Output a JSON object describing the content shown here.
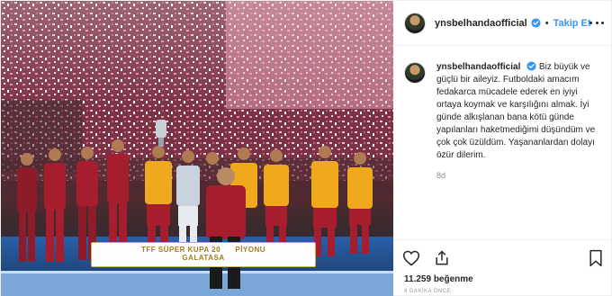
{
  "post": {
    "username": "ynsbelhandaofficial",
    "follow_label": "Takip Et",
    "caption": "Biz büyük ve güçlü bir aileyiz. Futboldaki amacım fedakarca mücadele ederek en iyiyi ortaya koymak ve karşılığını almak. İyi günde alkışlanan bana kötü günde yapılanları haketmediğimi düşündüm ve çok çok üzüldüm. Yaşananlardan dolayı özür dilerim.",
    "comment_time": "8d",
    "likes": "11.259 beğenme",
    "posted_ago": "8 DAKİKA ÖNCE"
  },
  "photo": {
    "banner_line1": "TFF SÜPER KUPA 20",
    "banner_line2": "GALATASA",
    "banner_suffix": "PİYONU"
  },
  "colors": {
    "link": "#3897f0",
    "verified": "#3897f0",
    "jersey_red": "#a61e2d",
    "jersey_yellow": "#f0a81c"
  },
  "icons": [
    "heart-icon",
    "share-icon",
    "bookmark-icon",
    "more-icon",
    "verified-icon"
  ]
}
